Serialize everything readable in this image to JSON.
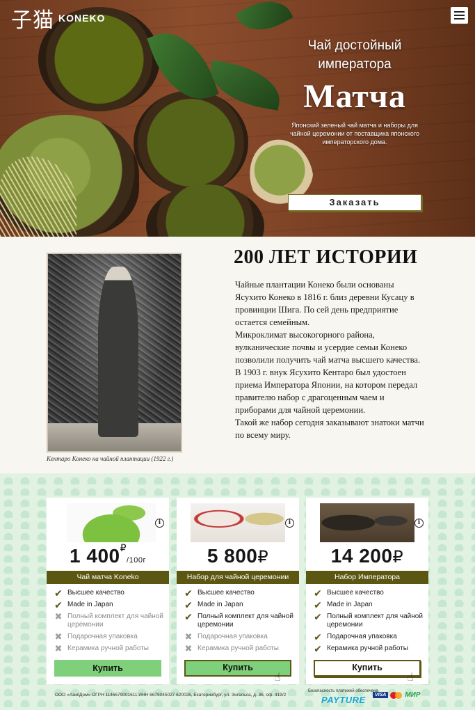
{
  "header": {
    "logo_kanji": "子猫",
    "logo_text": "KONEKO",
    "menu_icon": "hamburger-menu-icon"
  },
  "hero": {
    "tagline": "Чай достойный императора",
    "title": "Матча",
    "description": "Японский зеленый чай матча и наборы для чайной церемонии от поставщика японского императорского дома.",
    "cta_label": "Заказать"
  },
  "history": {
    "title": "200 ЛЕТ ИСТОРИИ",
    "paragraphs": [
      "Чайные плантации Конеко были основаны Ясухито Конеко в 1816 г. близ деревни Кусацу в провинции Шига. По сей день предприятие остается семейным.",
      "Микроклимат высокогорного района, вулканические почвы и усердие семьи Конеко позволили получить чай матча высшего качества.",
      "В 1903 г. внук Ясухито Кентаро был удостоен приема Императора Японии, на котором передал правителю набор с драгоценным чаем и приборами для чайной церемонии.",
      "Такой же набор сегодня заказывают знатоки матчи по всему миру."
    ],
    "photo_caption": "Кентаро Конеко на чайной плантации (1922 г.)"
  },
  "products": [
    {
      "price": "1 400",
      "currency": "₽",
      "unit": "/100г",
      "name": "Чай матча Koneko",
      "features": [
        {
          "text": "Высшее качество",
          "included": true
        },
        {
          "text": "Made in Japan",
          "included": true
        },
        {
          "text": "Полный комплект для чайной церемонии",
          "included": false
        },
        {
          "text": "Подарочная упаковка",
          "included": false
        },
        {
          "text": "Керамика ручной работы",
          "included": false
        }
      ],
      "button": "Купить"
    },
    {
      "price": "5 800",
      "currency": "₽",
      "unit": "",
      "name": "Набор для чайной церемонии",
      "features": [
        {
          "text": "Высшее качество",
          "included": true
        },
        {
          "text": "Made in Japan",
          "included": true
        },
        {
          "text": "Полный комплект для чайной церемонии",
          "included": true
        },
        {
          "text": "Подарочная упаковка",
          "included": false
        },
        {
          "text": "Керамика ручной работы",
          "included": false
        }
      ],
      "button": "Купить"
    },
    {
      "price": "14 200",
      "currency": "₽",
      "unit": "",
      "name": "Набор Императора",
      "features": [
        {
          "text": "Высшее качество",
          "included": true
        },
        {
          "text": "Made in Japan",
          "included": true
        },
        {
          "text": "Полный комплект для чайной церемонии",
          "included": true
        },
        {
          "text": "Подарочная упаковка",
          "included": true
        },
        {
          "text": "Керамика ручной работы",
          "included": true
        }
      ],
      "button": "Купить"
    }
  ],
  "footer": {
    "legal": "ООО «АзияДом» ОГРН 1146679001611 ИНН 6679045027 620026, Екатеринбург, ул. Энгельса, д. 36, оф. 419/2",
    "payment_note": "Безопасность платежей обеспечена",
    "payment_provider": "PAYTURE",
    "payment_systems": [
      "VISA",
      "Mastercard",
      "МИР"
    ]
  },
  "colors": {
    "accent_olive": "#5c5613",
    "buy_green": "#7ed07a",
    "pricing_bg": "#e1f2e3"
  }
}
